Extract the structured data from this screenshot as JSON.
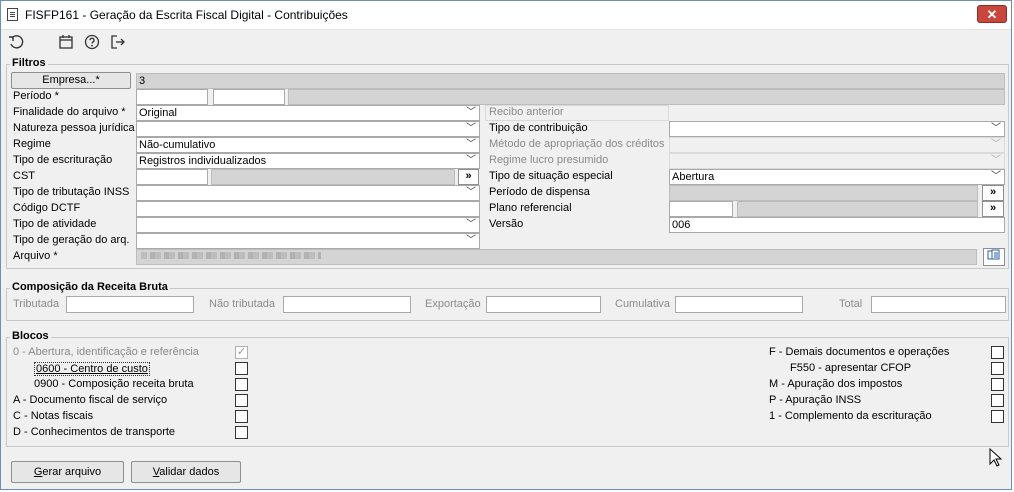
{
  "window": {
    "title": "FISFP161 - Geração da Escrita Fiscal Digital - Contribuições",
    "close": "✕"
  },
  "toolbar": {
    "icons": [
      "undo-icon",
      "calendar-icon",
      "help-icon",
      "exit-icon"
    ]
  },
  "filtros": {
    "title": "Filtros",
    "empresa_button": "Empresa...*",
    "empresa_value": "3",
    "periodo_label": "Período *",
    "periodo_from": "",
    "periodo_to": "",
    "finalidade_label": "Finalidade do arquivo *",
    "finalidade_value": "Original",
    "natureza_label": "Natureza pessoa jurídica",
    "natureza_value": "",
    "regime_label": "Regime",
    "regime_value": "Não-cumulativo",
    "tipo_escrituracao_label": "Tipo de escrituração",
    "tipo_escrituracao_value": "Registros individualizados",
    "cst_label": "CST",
    "cst_value": "",
    "tributacao_inss_label": "Tipo de tributação INSS",
    "tributacao_inss_value": "",
    "codigo_dctf_label": "Código DCTF",
    "codigo_dctf_value": "",
    "tipo_atividade_label": "Tipo de atividade",
    "tipo_atividade_value": "",
    "tipo_geracao_label": "Tipo de geração do arq.",
    "tipo_geracao_value": "",
    "arquivo_label": "Arquivo *",
    "recibo_label": "Recibo anterior",
    "tipo_contribuicao_label": "Tipo de contribuição",
    "tipo_contribuicao_value": "",
    "metodo_label": "Método de apropriação dos créditos",
    "regime_lucro_label": "Regime lucro presumido",
    "situacao_especial_label": "Tipo de situação especial",
    "situacao_especial_value": "Abertura",
    "periodo_dispensa_label": "Período de dispensa",
    "plano_referencial_label": "Plano referencial",
    "versao_label": "Versão",
    "versao_value": "006",
    "lookup_glyph": "»"
  },
  "composicao": {
    "title": "Composição da Receita Bruta",
    "tributada": "Tributada",
    "nao_tributada": "Não tributada",
    "exportacao": "Exportação",
    "cumulativa": "Cumulativa",
    "total": "Total"
  },
  "blocos": {
    "title": "Blocos",
    "left": [
      {
        "label": "0 - Abertura, identificação e referência",
        "checked": true
      },
      {
        "label": "0600 - Centro de custo",
        "checked": false
      },
      {
        "label": "0900 - Composição receita bruta",
        "checked": false
      },
      {
        "label": "A - Documento fiscal de serviço",
        "checked": false
      },
      {
        "label": "C - Notas fiscais",
        "checked": false
      },
      {
        "label": "D - Conhecimentos de transporte",
        "checked": false
      }
    ],
    "right": [
      {
        "label": "F - Demais documentos e operações",
        "checked": false
      },
      {
        "label": "F550 - apresentar CFOP",
        "checked": false
      },
      {
        "label": "M - Apuração dos impostos",
        "checked": false
      },
      {
        "label": "P - Apuração INSS",
        "checked": false
      },
      {
        "label": "1 - Complemento da escrituração",
        "checked": false
      }
    ],
    "check_glyph": "✓"
  },
  "footer": {
    "gerar_prefix": "G",
    "gerar_rest": "erar arquivo",
    "validar_prefix": "V",
    "validar_rest": "alidar dados"
  }
}
